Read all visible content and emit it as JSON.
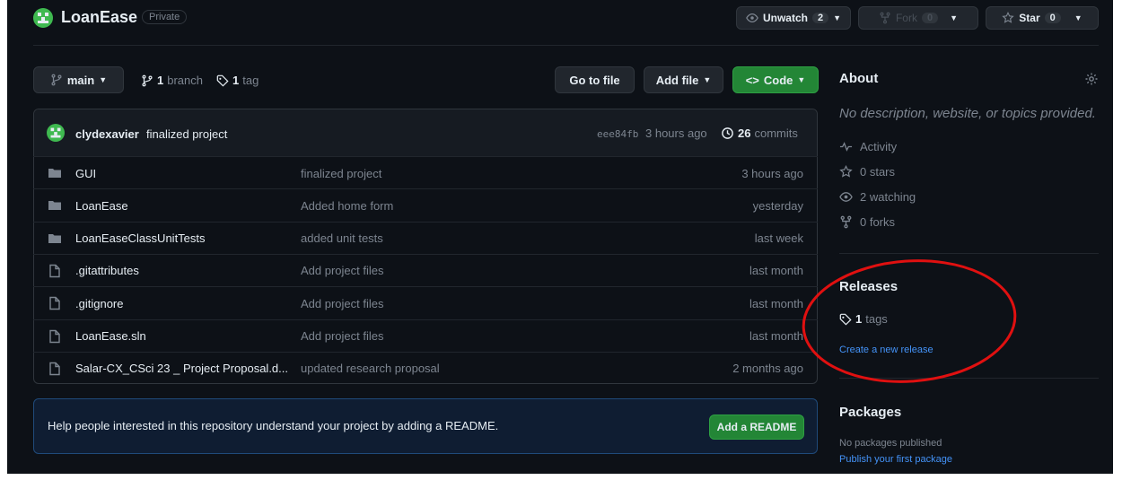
{
  "repo": {
    "name": "LoanEase",
    "visibility": "Private"
  },
  "header_actions": {
    "unwatch_label": "Unwatch",
    "unwatch_count": "2",
    "fork_label": "Fork",
    "fork_count": "0",
    "star_label": "Star",
    "star_count": "0"
  },
  "toolbar": {
    "branch_name": "main",
    "branches_count": "1",
    "branches_label": "branch",
    "tags_count": "1",
    "tags_label": "tag",
    "go_to_file": "Go to file",
    "add_file": "Add file",
    "code": "Code"
  },
  "commit": {
    "author": "clydexavier",
    "message": "finalized project",
    "hash": "eee84fb",
    "time": "3 hours ago",
    "commits_count": "26",
    "commits_label": "commits"
  },
  "files": [
    {
      "type": "folder",
      "name": "GUI",
      "message": "finalized project",
      "age": "3 hours ago"
    },
    {
      "type": "folder",
      "name": "LoanEase",
      "message": "Added home form",
      "age": "yesterday"
    },
    {
      "type": "folder",
      "name": "LoanEaseClassUnitTests",
      "message": "added unit tests",
      "age": "last week"
    },
    {
      "type": "file",
      "name": ".gitattributes",
      "message": "Add project files",
      "age": "last month"
    },
    {
      "type": "file",
      "name": ".gitignore",
      "message": "Add project files",
      "age": "last month"
    },
    {
      "type": "file",
      "name": "LoanEase.sln",
      "message": "Add project files",
      "age": "last month"
    },
    {
      "type": "file",
      "name": "Salar-CX_CSci 23 _ Project Proposal.d...",
      "message": "updated research proposal",
      "age": "2 months ago"
    }
  ],
  "readme_banner": {
    "text": "Help people interested in this repository understand your project by adding a README.",
    "button": "Add a README"
  },
  "about": {
    "title": "About",
    "description": "No description, website, or topics provided.",
    "activity": "Activity",
    "stars": "0 stars",
    "watching": "2 watching",
    "forks": "0 forks"
  },
  "releases": {
    "title": "Releases",
    "tags_count": "1",
    "tags_label": "tags",
    "create_link": "Create a new release"
  },
  "packages": {
    "title": "Packages",
    "none_text": "No packages published",
    "publish_link": "Publish your first package"
  },
  "colors": {
    "background": "#0d1117",
    "accent_green": "#238636",
    "link_blue": "#4493f8",
    "annotation_red": "#e01010"
  }
}
